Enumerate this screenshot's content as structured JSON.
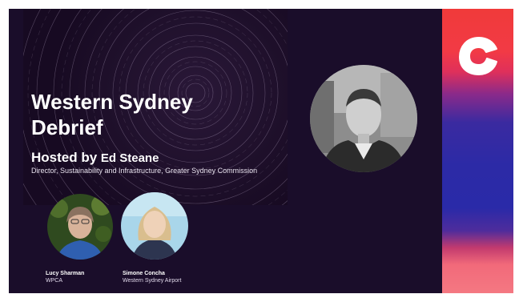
{
  "title_line1": "Western Sydney",
  "title_line2": "Debrief",
  "hosted_prefix": "Hosted by ",
  "host_name": "Ed Steane",
  "host_role": "Director, Sustainability and Infrastructure, Greater Sydney Commission",
  "panelists": [
    {
      "name": "Lucy Sharman",
      "org": "WPCA"
    },
    {
      "name": "Simone Concha",
      "org": "Western Sydney Airport"
    }
  ],
  "icons": [
    "host-photo-icon",
    "brand-logo-icon"
  ],
  "colors": {
    "background": "#1a0d2a",
    "brand_red": "#f03a3a",
    "brand_blue": "#2a2aa8"
  }
}
